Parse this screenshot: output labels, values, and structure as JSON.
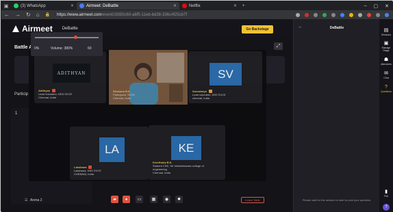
{
  "browser": {
    "tabs": [
      {
        "label": "(3) WhatsApp",
        "color": "#25d366"
      },
      {
        "label": "Airmeet: DeBattle",
        "color": "#4b7bf5",
        "active": true
      },
      {
        "label": "Netflix",
        "color": "#e50914"
      }
    ],
    "new_tab": "+",
    "url_host": "https://www.airmeet.com",
    "url_path": "/event/1fd50c60-a6f5-11eb-bd38-336c4f25cb7f",
    "window_controls": [
      "–",
      "▢",
      "✕"
    ],
    "extension_colors": [
      "#aaaaaa",
      "#d93025",
      "#888888",
      "#34a853",
      "#888888",
      "#4285f4",
      "#f4b400",
      "#aaaaaa",
      "#ea4335",
      "#888888",
      "#4285f4"
    ]
  },
  "header": {
    "logo": "Airmeet",
    "event_name": "DeBattle",
    "backstage_label": "Go Backstage"
  },
  "main": {
    "arena_title": "Battle Arena",
    "participants_label": "Particip",
    "table_number": "1",
    "arena_select": "Arena 2",
    "leave_label": "Leave Table"
  },
  "participants": [
    {
      "name": "Adithyan",
      "role": "Lead Volunteer, NSS SVCE",
      "location": "Chennai, India",
      "initials": "",
      "banner": "ADITHYAN"
    },
    {
      "name": "Shobana B.K.",
      "role": "Participant, SVCE",
      "location": "Chennai, India",
      "initials": ""
    },
    {
      "name": "Soundarya",
      "role": "Lead volunteer, NSS SVCE",
      "location": "chennai, India",
      "initials": "SV"
    },
    {
      "name": "Lakshana",
      "role": "Lakshana, NSS SVCE",
      "location": "CHENNAI, India",
      "initials": "LA"
    },
    {
      "name": "Keerthana B.K.",
      "role": "Student CSE, Sri Venkateswara college of",
      "role2": "engineering",
      "location": "Chennai, India",
      "initials": "KE"
    }
  ],
  "right_panel": {
    "title": "DeBattle",
    "volume_min": "0%",
    "volume_label": "Volume: 380%",
    "volume_max": "60",
    "volume_fraction": 0.63,
    "qa_hint": "Please wait for the session to start to post your question."
  },
  "sidebar": [
    {
      "label": "Sessions",
      "glyph": "▤"
    },
    {
      "label": "Manage Stage",
      "glyph": "▣"
    },
    {
      "label": "Attendees",
      "glyph": "☗"
    },
    {
      "label": "Chat",
      "glyph": "✉"
    },
    {
      "label": "Questions",
      "glyph": "?",
      "active": true
    },
    {
      "label": "Poll",
      "glyph": "▮"
    }
  ],
  "help_glyph": "?"
}
